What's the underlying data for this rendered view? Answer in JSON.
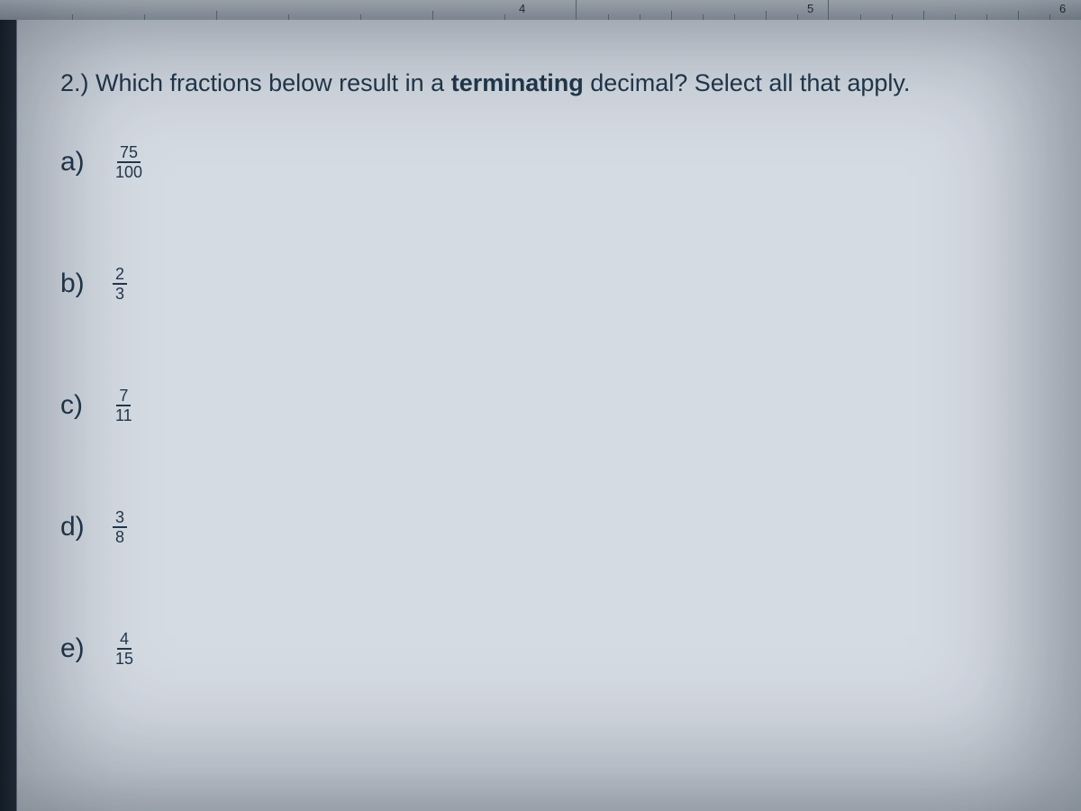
{
  "ruler": {
    "marks": [
      "4",
      "5",
      "6"
    ]
  },
  "question": {
    "number": "2.)",
    "text_before": "Which fractions below result in a ",
    "bold_word": "terminating",
    "text_after": " decimal? Select all that apply."
  },
  "options": [
    {
      "label": "a)",
      "numerator": "75",
      "denominator": "100"
    },
    {
      "label": "b)",
      "numerator": "2",
      "denominator": "3"
    },
    {
      "label": "c)",
      "numerator": "7",
      "denominator": "11"
    },
    {
      "label": "d)",
      "numerator": "3",
      "denominator": "8"
    },
    {
      "label": "e)",
      "numerator": "4",
      "denominator": "15"
    }
  ]
}
